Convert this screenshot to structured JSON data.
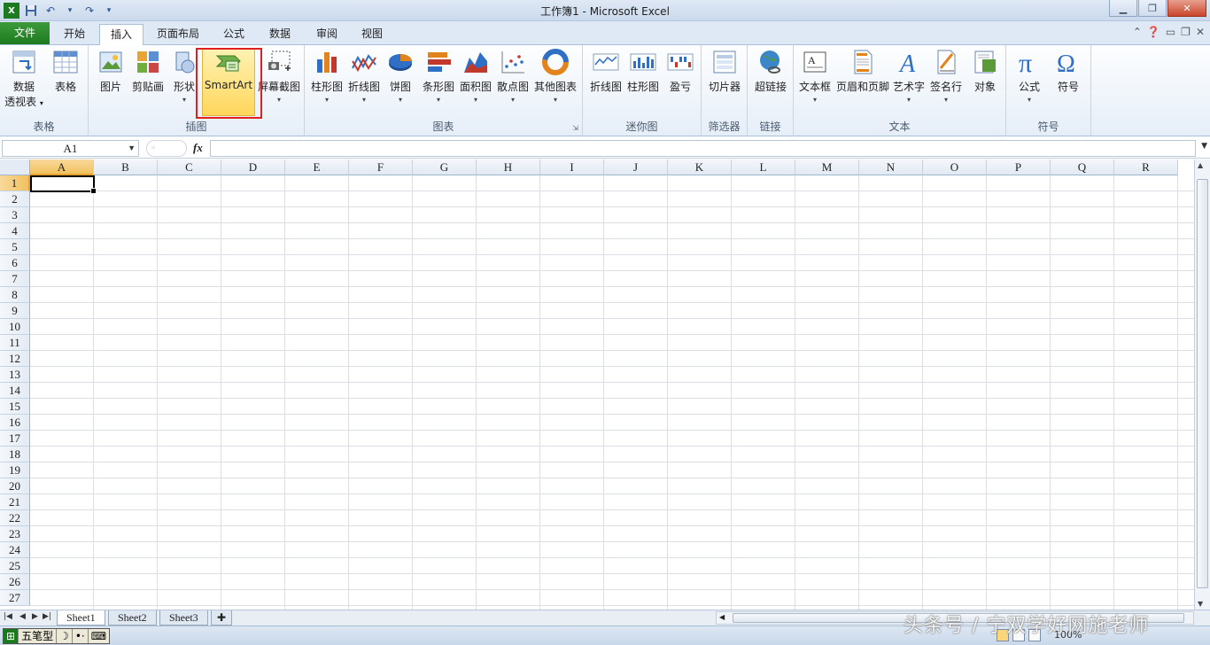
{
  "window": {
    "title": "工作簿1 - Microsoft Excel"
  },
  "qat": {
    "save": "save-icon",
    "undo": "undo-icon",
    "redo": "redo-icon",
    "customize": "▾"
  },
  "tabs": [
    "文件",
    "开始",
    "插入",
    "页面布局",
    "公式",
    "数据",
    "审阅",
    "视图"
  ],
  "active_tab": "插入",
  "ribbon": {
    "groups": {
      "tables": "表格",
      "illustrations": "插图",
      "charts": "图表",
      "sparklines": "迷你图",
      "filter": "筛选器",
      "links": "链接",
      "text": "文本",
      "symbols": "符号"
    },
    "buttons": {
      "pivot_line1": "数据",
      "pivot_line2": "透视表",
      "table": "表格",
      "picture": "图片",
      "clipart": "剪贴画",
      "shapes": "形状",
      "smartart": "SmartArt",
      "screenshot": "屏幕截图",
      "column": "柱形图",
      "line": "折线图",
      "pie": "饼图",
      "bar": "条形图",
      "area": "面积图",
      "scatter": "散点图",
      "other": "其他图表",
      "spark_line": "折线图",
      "spark_column": "柱形图",
      "spark_winloss": "盈亏",
      "slicer": "切片器",
      "hyperlink": "超链接",
      "textbox": "文本框",
      "header_footer": "页眉和页脚",
      "wordart": "艺术字",
      "signature": "签名行",
      "object": "对象",
      "equation": "公式",
      "symbol": "符号"
    }
  },
  "formula_bar": {
    "name_box": "A1",
    "fx": "fx",
    "value": ""
  },
  "columns": [
    "A",
    "B",
    "C",
    "D",
    "E",
    "F",
    "G",
    "H",
    "I",
    "J",
    "K",
    "L",
    "M",
    "N",
    "O",
    "P",
    "Q",
    "R"
  ],
  "rows": [
    "1",
    "2",
    "3",
    "4",
    "5",
    "6",
    "7",
    "8",
    "9",
    "10",
    "11",
    "12",
    "13",
    "14",
    "15",
    "16",
    "17",
    "18",
    "19",
    "20",
    "21",
    "22",
    "23",
    "24",
    "25",
    "26",
    "27"
  ],
  "sheets": [
    "Sheet1",
    "Sheet2",
    "Sheet3"
  ],
  "active_sheet": "Sheet1",
  "status": {
    "ime": [
      "五笔型"
    ],
    "zoom": "100%"
  },
  "watermark": "头条号 / 宁双学好网施老师"
}
